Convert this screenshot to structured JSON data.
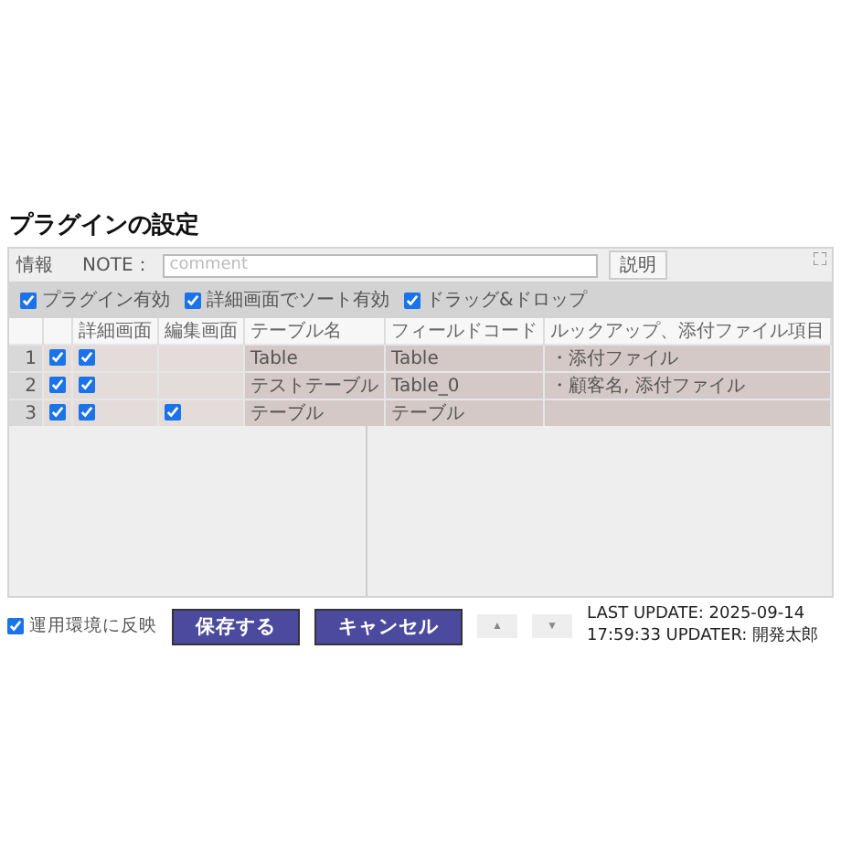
{
  "title": "プラグインの設定",
  "panel": {
    "info_label": "情報",
    "note": {
      "label": "NOTE：",
      "placeholder": "comment"
    },
    "help_button": "説明",
    "options": [
      {
        "label": "プラグイン有効",
        "checked": true
      },
      {
        "label": "詳細画面でソート有効",
        "checked": true
      },
      {
        "label": "ドラッグ&ドロップ",
        "checked": true
      }
    ],
    "table": {
      "columns": [
        "詳細画面",
        "編集画面",
        "テーブル名",
        "フィールドコード",
        "ルックアップ、添付ファイル項目"
      ],
      "rows": [
        {
          "number": "1",
          "enabled": true,
          "detail": true,
          "edit": false,
          "table_name": "Table",
          "field_code": "Table",
          "lookup": "・添付ファイル"
        },
        {
          "number": "2",
          "enabled": true,
          "detail": true,
          "edit": false,
          "table_name": "テストテーブル",
          "field_code": "Table_0",
          "lookup": "・顧客名, 添付ファイル"
        },
        {
          "number": "3",
          "enabled": true,
          "detail": true,
          "edit": true,
          "table_name": "テーブル",
          "field_code": "テーブル",
          "lookup": ""
        }
      ]
    }
  },
  "footer": {
    "deploy": {
      "label": "運用環境に反映",
      "checked": true
    },
    "save_button": "保存する",
    "cancel_button": "キャンセル",
    "prev_button": "▲",
    "next_button": "▼",
    "last_update": "LAST UPDATE: 2025-09-14 17:59:33 UPDATER: 開発太郎"
  }
}
